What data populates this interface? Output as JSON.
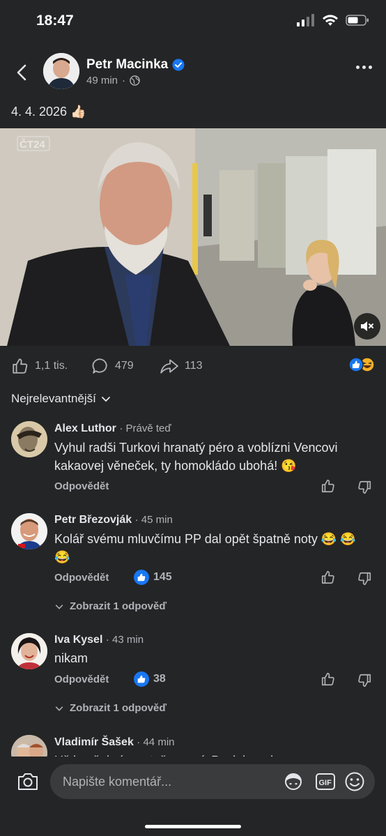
{
  "status": {
    "time": "18:47"
  },
  "post": {
    "author": "Petr Macinka",
    "time": "49 min",
    "text": "4. 4. 2026",
    "emoji": "👍🏻",
    "video": {
      "channel_logo": "ČT24"
    }
  },
  "actions": {
    "likes": "1,1 tis.",
    "comments": "479",
    "shares": "113"
  },
  "sort_label": "Nejrelevantnější",
  "comments": [
    {
      "name": "Alex Luthor",
      "time": "Právě teď",
      "text": "Vyhul radši Turkovi hranatý péro a voblízni Vencovi kakaovej věneček, ty homokládo ubohá! 😘",
      "reply_label": "Odpovědět"
    },
    {
      "name": "Petr Březovják",
      "time": "45 min",
      "text": "Kolář svému mluvčímu PP dal opět špatně noty 😂 😂 😂",
      "reply_label": "Odpovědět",
      "likes": "145",
      "show_replies": "Zobrazit 1 odpověď"
    },
    {
      "name": "Iva Kysel",
      "time": "43 min",
      "text": "nikam",
      "reply_label": "Odpovědět",
      "likes": "38",
      "show_replies": "Zobrazit 1 odpověď"
    },
    {
      "name": "Vladimír Šašek",
      "time": "44 min",
      "text": "Už jen šabrá, protože musí. Poslal markoz..."
    }
  ],
  "composer": {
    "placeholder": "Napište komentář...",
    "gif_label": "GIF"
  },
  "colors": {
    "background": "#242526",
    "accent": "#1877f2"
  }
}
